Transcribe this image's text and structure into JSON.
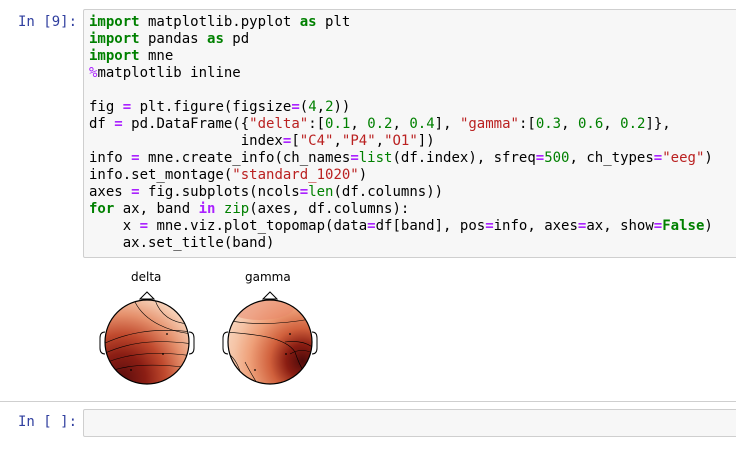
{
  "cells": [
    {
      "prompt": "In [9]:",
      "code_lines": [
        [
          {
            "t": "import",
            "c": "kw"
          },
          {
            "t": " matplotlib.pyplot "
          },
          {
            "t": "as",
            "c": "kw"
          },
          {
            "t": " plt"
          }
        ],
        [
          {
            "t": "import",
            "c": "kw"
          },
          {
            "t": " pandas "
          },
          {
            "t": "as",
            "c": "kw"
          },
          {
            "t": " pd"
          }
        ],
        [
          {
            "t": "import",
            "c": "kw"
          },
          {
            "t": " mne"
          }
        ],
        [
          {
            "t": "%",
            "c": "magic"
          },
          {
            "t": "matplotlib inline"
          }
        ],
        [
          {
            "t": ""
          }
        ],
        [
          {
            "t": "fig "
          },
          {
            "t": "=",
            "c": "op"
          },
          {
            "t": " plt.figure(figsize"
          },
          {
            "t": "=",
            "c": "op"
          },
          {
            "t": "("
          },
          {
            "t": "4",
            "c": "num"
          },
          {
            "t": ","
          },
          {
            "t": "2",
            "c": "num"
          },
          {
            "t": "))"
          }
        ],
        [
          {
            "t": "df "
          },
          {
            "t": "=",
            "c": "op"
          },
          {
            "t": " pd.DataFrame({"
          },
          {
            "t": "\"delta\"",
            "c": "str"
          },
          {
            "t": ":["
          },
          {
            "t": "0.1",
            "c": "num"
          },
          {
            "t": ", "
          },
          {
            "t": "0.2",
            "c": "num"
          },
          {
            "t": ", "
          },
          {
            "t": "0.4",
            "c": "num"
          },
          {
            "t": "], "
          },
          {
            "t": "\"gamma\"",
            "c": "str"
          },
          {
            "t": ":["
          },
          {
            "t": "0.3",
            "c": "num"
          },
          {
            "t": ", "
          },
          {
            "t": "0.6",
            "c": "num"
          },
          {
            "t": ", "
          },
          {
            "t": "0.2",
            "c": "num"
          },
          {
            "t": "]},"
          }
        ],
        [
          {
            "t": "                  index"
          },
          {
            "t": "=",
            "c": "op"
          },
          {
            "t": "["
          },
          {
            "t": "\"C4\"",
            "c": "str"
          },
          {
            "t": ","
          },
          {
            "t": "\"P4\"",
            "c": "str"
          },
          {
            "t": ","
          },
          {
            "t": "\"O1\"",
            "c": "str"
          },
          {
            "t": "])"
          }
        ],
        [
          {
            "t": "info "
          },
          {
            "t": "=",
            "c": "op"
          },
          {
            "t": " mne.create_info(ch_names"
          },
          {
            "t": "=",
            "c": "op"
          },
          {
            "t": "list",
            "c": "bi"
          },
          {
            "t": "(df.index), sfreq"
          },
          {
            "t": "=",
            "c": "op"
          },
          {
            "t": "500",
            "c": "num"
          },
          {
            "t": ", ch_types"
          },
          {
            "t": "=",
            "c": "op"
          },
          {
            "t": "\"eeg\"",
            "c": "str"
          },
          {
            "t": ")"
          }
        ],
        [
          {
            "t": "info.set_montage("
          },
          {
            "t": "\"standard_1020\"",
            "c": "str"
          },
          {
            "t": ")"
          }
        ],
        [
          {
            "t": "axes "
          },
          {
            "t": "=",
            "c": "op"
          },
          {
            "t": " fig.subplots(ncols"
          },
          {
            "t": "=",
            "c": "op"
          },
          {
            "t": "len",
            "c": "bi"
          },
          {
            "t": "(df.columns))"
          }
        ],
        [
          {
            "t": "for",
            "c": "kw"
          },
          {
            "t": " ax, band "
          },
          {
            "t": "in",
            "c": "op"
          },
          {
            "t": " "
          },
          {
            "t": "zip",
            "c": "bi"
          },
          {
            "t": "(axes, df.columns):"
          }
        ],
        [
          {
            "t": "    x "
          },
          {
            "t": "=",
            "c": "op"
          },
          {
            "t": " mne.viz.plot_topomap(data"
          },
          {
            "t": "=",
            "c": "op"
          },
          {
            "t": "df[band], pos"
          },
          {
            "t": "=",
            "c": "op"
          },
          {
            "t": "info, axes"
          },
          {
            "t": "=",
            "c": "op"
          },
          {
            "t": "ax, show"
          },
          {
            "t": "=",
            "c": "op"
          },
          {
            "t": "False",
            "c": "kw"
          },
          {
            "t": ")"
          }
        ],
        [
          {
            "t": "    ax.set_title(band)"
          }
        ]
      ]
    },
    {
      "prompt": "In [ ]:",
      "code_lines": []
    }
  ],
  "output": {
    "plot_titles": [
      "delta",
      "gamma"
    ]
  }
}
